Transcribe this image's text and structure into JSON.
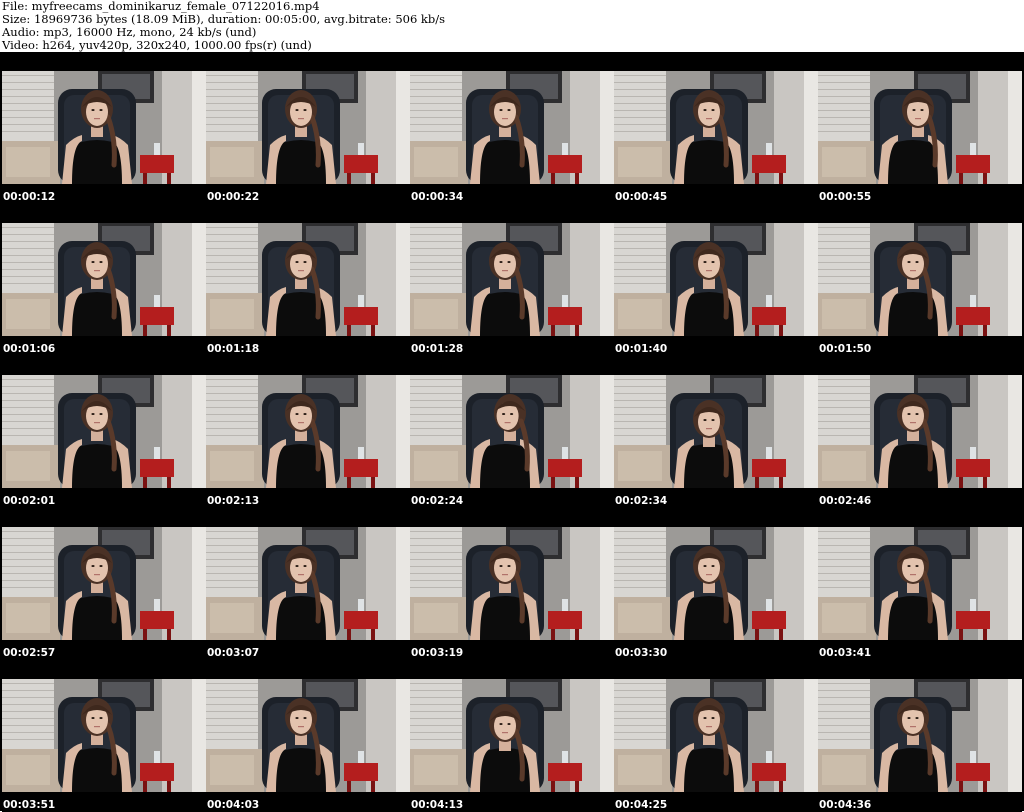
{
  "header": {
    "file_line": "File: myfreecams_dominikaruz_female_07122016.mp4",
    "size_line": "Size: 18969736 bytes (18.09 MiB), duration: 00:05:00, avg.bitrate: 506 kb/s",
    "audio_line": "Audio: mp3, 16000 Hz, mono, 24 kb/s (und)",
    "video_line": "Video: h264, yuv420p, 320x240, 1000.00 fps(r) (und)"
  },
  "thumbnails": [
    {
      "timestamp": "00:00:12",
      "pose": "center"
    },
    {
      "timestamp": "00:00:22",
      "pose": "center"
    },
    {
      "timestamp": "00:00:34",
      "pose": "center"
    },
    {
      "timestamp": "00:00:45",
      "pose": "center"
    },
    {
      "timestamp": "00:00:55",
      "pose": "right"
    },
    {
      "timestamp": "00:01:06",
      "pose": "center"
    },
    {
      "timestamp": "00:01:18",
      "pose": "center"
    },
    {
      "timestamp": "00:01:28",
      "pose": "center"
    },
    {
      "timestamp": "00:01:40",
      "pose": "center"
    },
    {
      "timestamp": "00:01:50",
      "pose": "center"
    },
    {
      "timestamp": "00:02:01",
      "pose": "center"
    },
    {
      "timestamp": "00:02:13",
      "pose": "center"
    },
    {
      "timestamp": "00:02:24",
      "pose": "turned"
    },
    {
      "timestamp": "00:02:34",
      "pose": "down"
    },
    {
      "timestamp": "00:02:46",
      "pose": "center"
    },
    {
      "timestamp": "00:02:57",
      "pose": "center"
    },
    {
      "timestamp": "00:03:07",
      "pose": "center"
    },
    {
      "timestamp": "00:03:19",
      "pose": "center"
    },
    {
      "timestamp": "00:03:30",
      "pose": "center"
    },
    {
      "timestamp": "00:03:41",
      "pose": "center"
    },
    {
      "timestamp": "00:03:51",
      "pose": "center"
    },
    {
      "timestamp": "00:04:03",
      "pose": "center"
    },
    {
      "timestamp": "00:04:13",
      "pose": "down"
    },
    {
      "timestamp": "00:04:25",
      "pose": "center"
    },
    {
      "timestamp": "00:04:36",
      "pose": "center"
    }
  ],
  "colors": {
    "header_bg": "#ffffff",
    "header_text": "#000000",
    "sheet_bg": "#000000",
    "timestamp_text": "#ffffff"
  }
}
